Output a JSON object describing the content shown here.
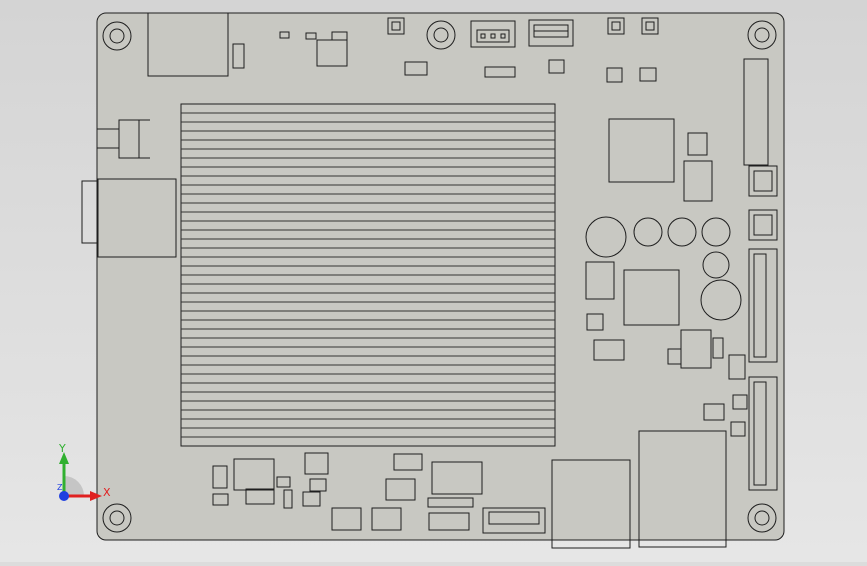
{
  "viewport": {
    "background": "#d9d9d9",
    "model_name": "mini-itx-motherboard"
  },
  "colors": {
    "board": "#c8c8c2",
    "outline": "#1e1e1e",
    "fin": "#333333",
    "axis_x": "#e02020",
    "axis_y": "#30b030",
    "axis_z": "#2040e0"
  },
  "triad": {
    "x_label": "X",
    "y_label": "Y",
    "z_label": "Z"
  }
}
